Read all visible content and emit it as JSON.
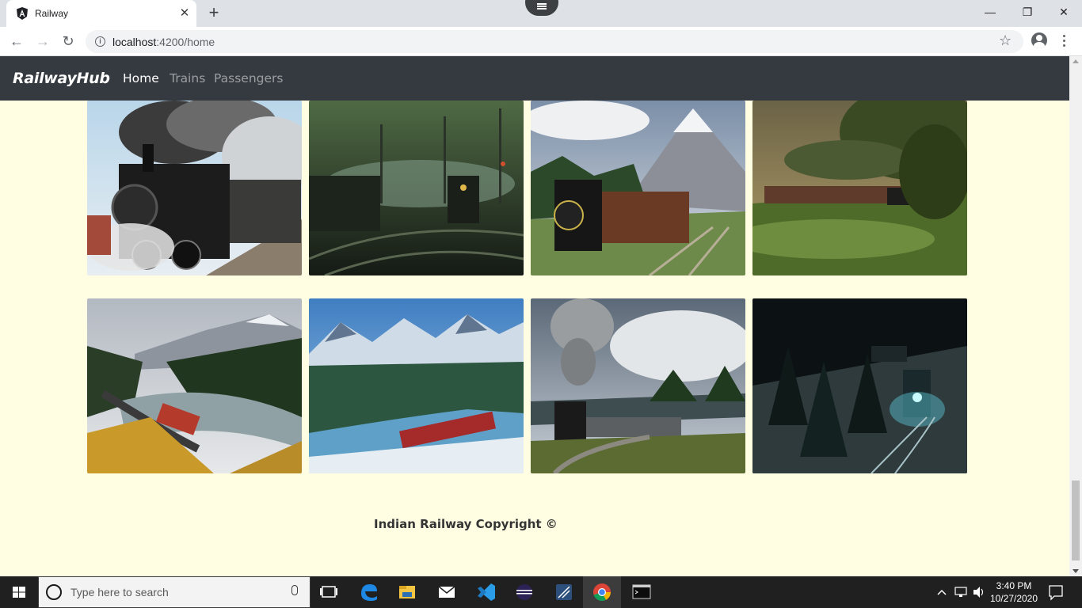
{
  "browser": {
    "tab_title": "Railway",
    "new_tab_label": "+",
    "close_tab_label": "✕",
    "url_host": "localhost",
    "url_rest": ":4200/home"
  },
  "app": {
    "brand": "RailwayHub",
    "nav": [
      "Home",
      "Trains",
      "Passengers"
    ],
    "active_nav": "Home",
    "footer": "Indian Railway Copyright ©"
  },
  "gallery": [
    {
      "subject": "steam-locomotive-smoke"
    },
    {
      "subject": "dark-rail-yard-night"
    },
    {
      "subject": "steam-train-mountains"
    },
    {
      "subject": "train-green-countryside"
    },
    {
      "subject": "freight-train-river-autumn"
    },
    {
      "subject": "red-train-snowy-mountains"
    },
    {
      "subject": "steam-train-cloudy-sky"
    },
    {
      "subject": "train-snowy-forest-night"
    }
  ],
  "taskbar": {
    "search_placeholder": "Type here to search",
    "time": "3:40 PM",
    "date": "10/27/2020"
  },
  "colors": {
    "page_background": "#fffee2",
    "navbar": "#343a40",
    "taskbar": "#202020"
  }
}
